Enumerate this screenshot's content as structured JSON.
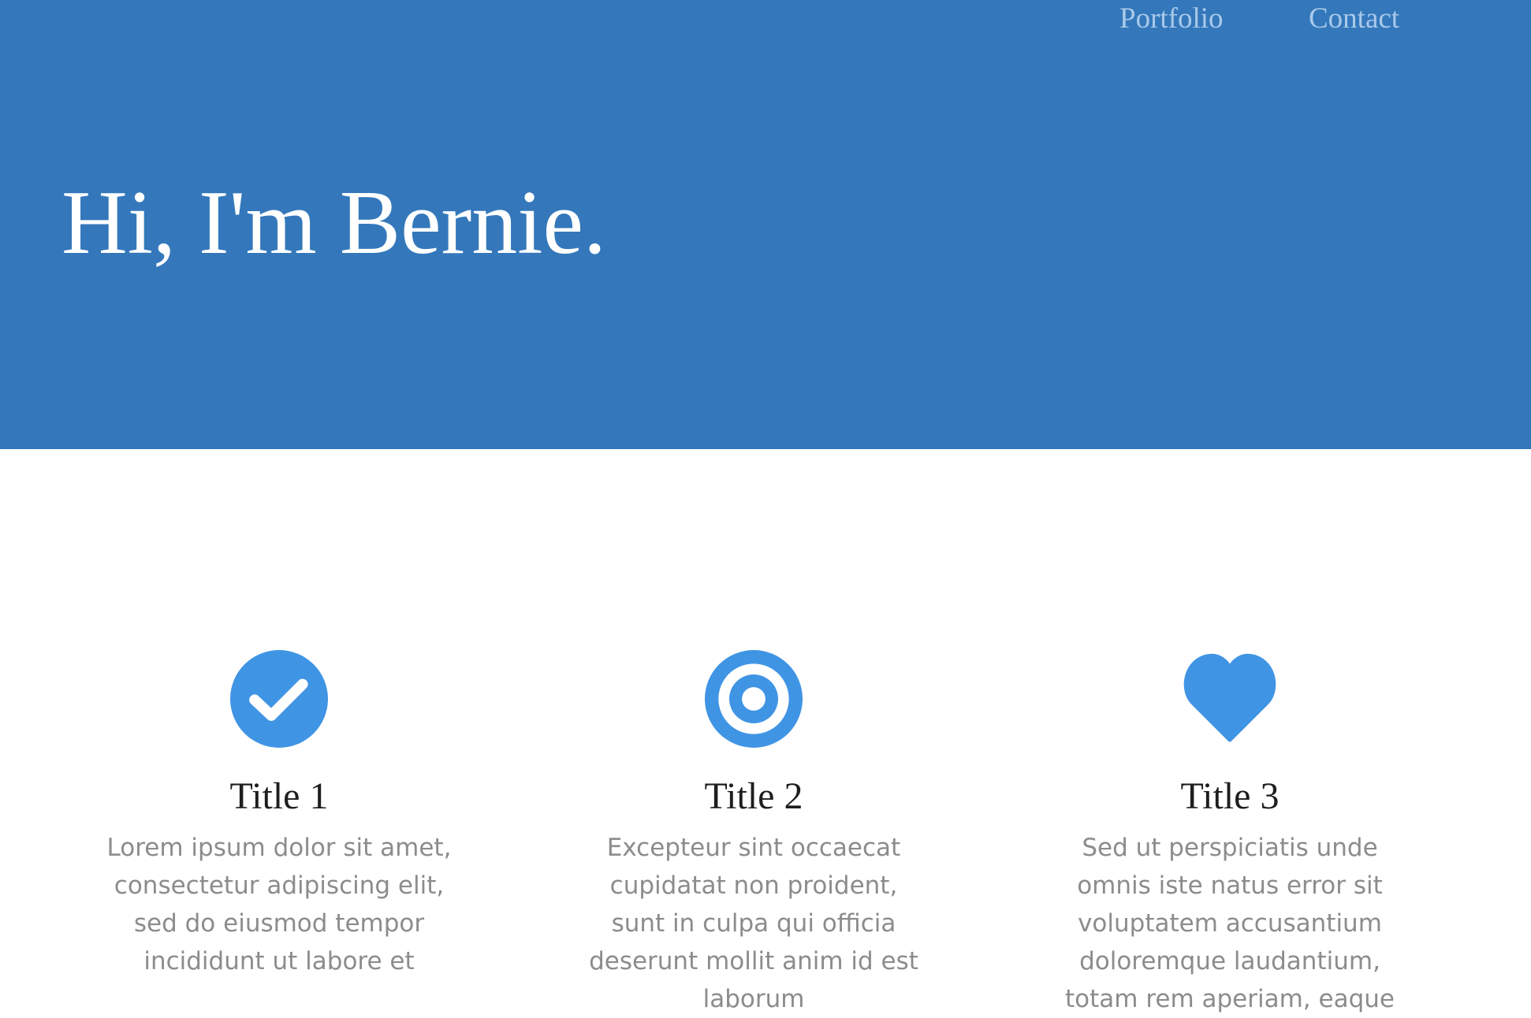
{
  "nav": {
    "links": [
      "Portfolio",
      "Contact"
    ]
  },
  "hero": {
    "title": "Hi, I'm Bernie."
  },
  "colors": {
    "hero_bg": "#3478bb",
    "icon_blue": "#4094e4",
    "nav_link": "#a9c9ea"
  },
  "features": [
    {
      "icon": "check-circle-icon",
      "title": "Title 1",
      "text": "Lorem ipsum dolor sit amet, consectetur adipiscing elit, sed do eiusmod tempor incididunt ut labore et"
    },
    {
      "icon": "target-icon",
      "title": "Title 2",
      "text": "Excepteur sint occaecat cupidatat non proident, sunt in culpa qui officia deserunt mollit anim id est laborum"
    },
    {
      "icon": "heart-icon",
      "title": "Title 3",
      "text": "Sed ut perspiciatis unde omnis iste natus error sit voluptatem accusantium doloremque laudantium, totam rem aperiam, eaque"
    }
  ]
}
